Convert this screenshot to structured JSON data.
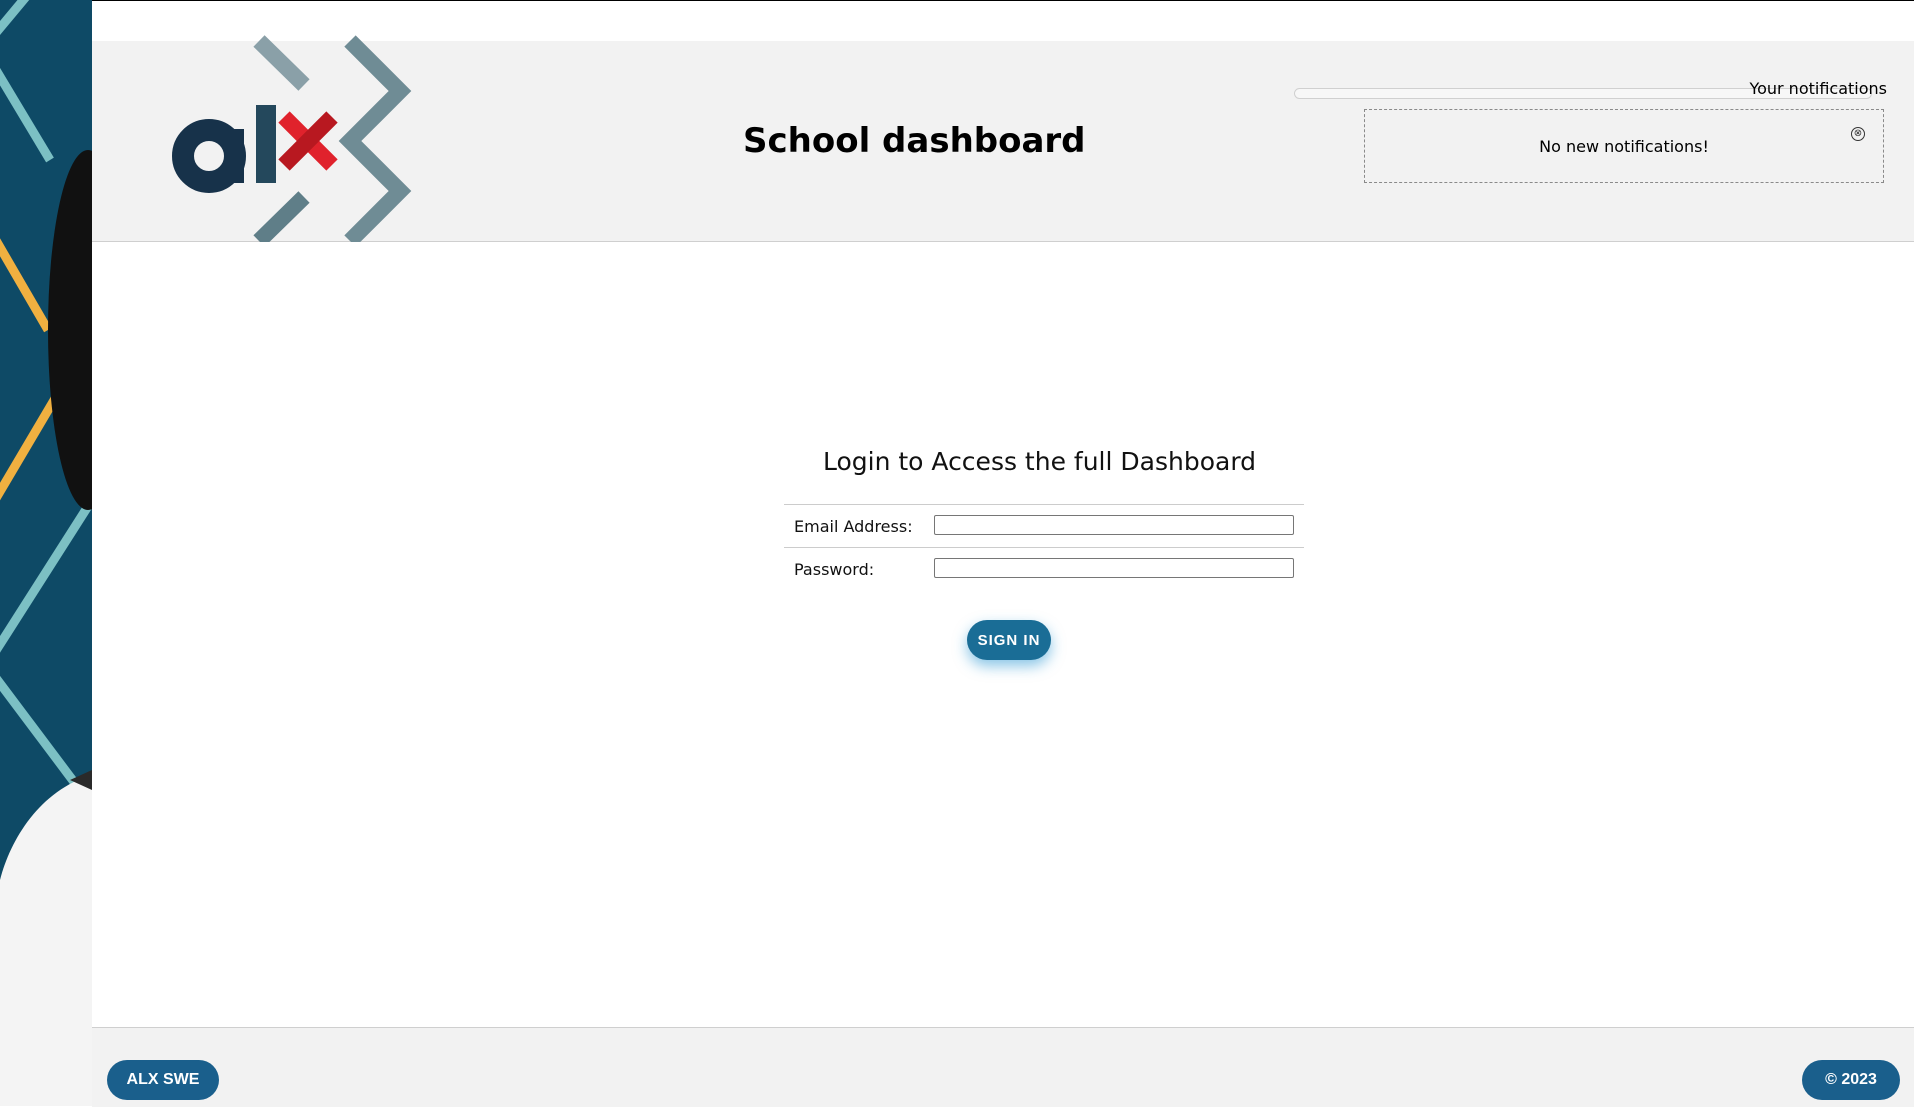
{
  "header": {
    "title": "School dashboard",
    "logo_text": "alx"
  },
  "notifications": {
    "title": "Your notifications",
    "message": "No new notifications!",
    "close_glyph": "⊗"
  },
  "login": {
    "heading": "Login to Access the full Dashboard",
    "email_label": "Email Address:",
    "email_value": "",
    "password_label": "Password:",
    "password_value": "",
    "submit_label": "SIGN IN"
  },
  "footer": {
    "left_label": "ALX SWE",
    "right_label": "© 2023"
  },
  "colors": {
    "brand_blue": "#1a6d96",
    "header_bg": "#f2f2f2",
    "strip_bg": "#0e4a66",
    "logo_red": "#e0222c",
    "logo_dark": "#17324a"
  }
}
